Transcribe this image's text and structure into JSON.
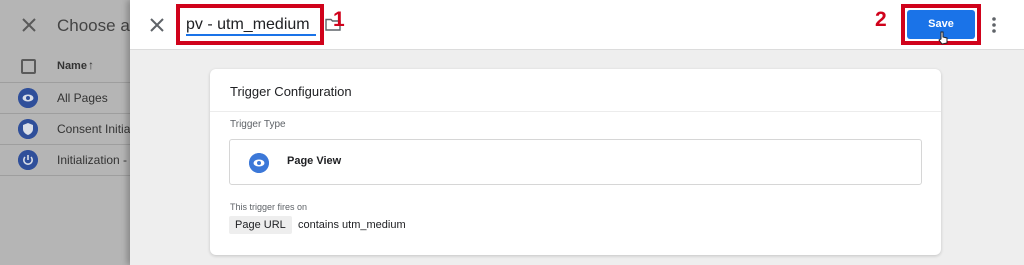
{
  "background_panel": {
    "title": "Choose a",
    "column_header": "Name",
    "rows": [
      {
        "label": "All Pages",
        "icon": "eye-icon"
      },
      {
        "label": "Consent Initia",
        "icon": "shield-icon"
      },
      {
        "label": "Initialization -",
        "icon": "power-icon"
      }
    ]
  },
  "header": {
    "tag_name": "pv - utm_medium",
    "marker_1": "1",
    "marker_2": "2",
    "save_label": "Save"
  },
  "card": {
    "title": "Trigger Configuration",
    "type_label": "Trigger Type",
    "trigger_type": "Page View",
    "fires_on_label": "This trigger fires on",
    "condition": {
      "variable": "Page URL",
      "operator_value": "contains utm_medium"
    }
  },
  "colors": {
    "accent": "#1a73e8",
    "highlight": "#d0021b",
    "icon_blue": "#3c78d8"
  }
}
